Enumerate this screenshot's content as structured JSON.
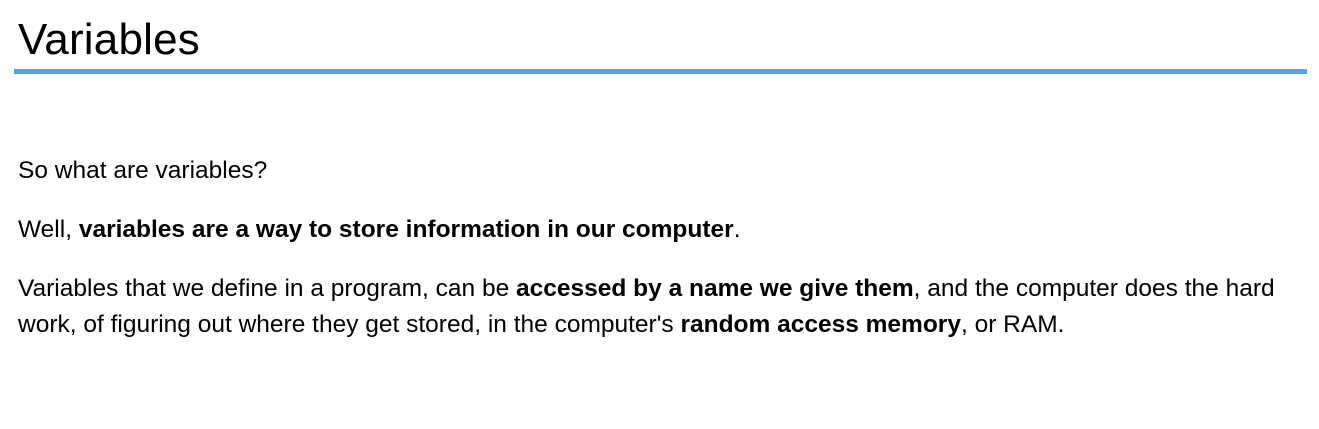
{
  "title": "Variables",
  "accent_color": "#4da3f0",
  "paragraphs": {
    "p1": {
      "text": "So what are variables?"
    },
    "p2": {
      "pre": "Well, ",
      "bold": "variables are a way to store information in our computer",
      "post": "."
    },
    "p3": {
      "pre": "Variables that we define in a program, can be ",
      "bold1": "accessed by a name we give them",
      "mid": ", and the computer does the hard work, of figuring out where they get stored, in the computer's ",
      "bold2": "random access memory",
      "post": ", or RAM."
    }
  }
}
